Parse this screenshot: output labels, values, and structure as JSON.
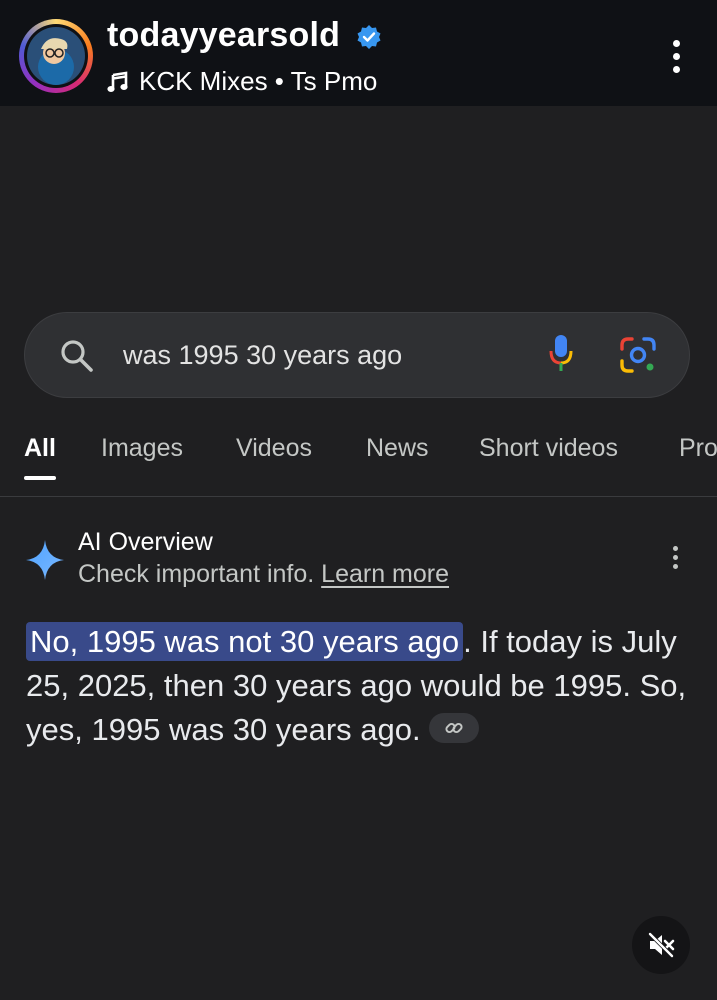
{
  "header": {
    "username": "todayyearsold",
    "verified_icon": "verified-badge-icon",
    "music_icon": "music-note-icon",
    "music_text": "KCK Mixes • Ts Pmo",
    "more_icon": "more-vertical-icon"
  },
  "search": {
    "query": "was 1995 30 years ago",
    "search_icon": "search-icon",
    "mic_icon": "microphone-icon",
    "lens_icon": "google-lens-icon"
  },
  "tabs": [
    {
      "label": "All",
      "active": true
    },
    {
      "label": "Images"
    },
    {
      "label": "Videos"
    },
    {
      "label": "News"
    },
    {
      "label": "Short videos"
    },
    {
      "label": "Pro"
    }
  ],
  "ai_overview": {
    "icon": "sparkle-icon",
    "title": "AI Overview",
    "subtitle_prefix": "Check important info.",
    "learn_more": "Learn more",
    "highlighted": "No, 1995 was not 30 years ago",
    "answer_rest": ". If today is July 25, 2025, then 30 years ago would be 1995. So, yes, 1995 was 30 years ago.",
    "link_icon": "link-icon"
  },
  "controls": {
    "mute_icon": "muted-speaker-icon"
  },
  "colors": {
    "highlight": "#394a8a",
    "background": "#1f1f21",
    "verified": "#3897f0"
  }
}
